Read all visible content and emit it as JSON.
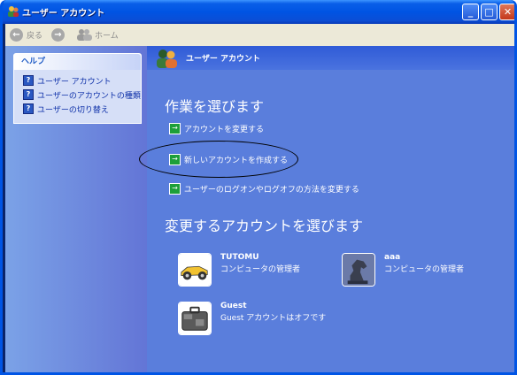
{
  "window": {
    "title": "ユーザー アカウント",
    "minimize": "_",
    "maximize": "□",
    "close": "✕"
  },
  "toolbar": {
    "back_label": "戻る",
    "home_label": "ホーム",
    "back_glyph": "←",
    "forward_glyph": "→"
  },
  "help": {
    "title": "ヘルプ",
    "items": [
      {
        "label": "ユーザー アカウント"
      },
      {
        "label": "ユーザーのアカウントの種類"
      },
      {
        "label": "ユーザーの切り替え"
      }
    ],
    "icon_glyph": "?"
  },
  "header": {
    "title": "ユーザー アカウント"
  },
  "tasks": {
    "heading": "作業を選びます",
    "arrow_glyph": "→",
    "items": [
      {
        "label": "アカウントを変更する"
      },
      {
        "label": "新しいアカウントを作成する"
      },
      {
        "label": "ユーザーのログオンやログオフの方法を変更する"
      }
    ]
  },
  "accounts": {
    "heading": "変更するアカウントを選びます",
    "items": [
      {
        "name": "TUTOMU",
        "role": "コンピュータの管理者",
        "picture": "race-car"
      },
      {
        "name": "aaa",
        "role": "コンピュータの管理者",
        "picture": "horse-chess-piece"
      },
      {
        "name": "Guest",
        "role": "Guest アカウントはオフです",
        "picture": "suitcase"
      }
    ]
  },
  "colors": {
    "titlebar": "#0054e3",
    "content": "#5a7edc",
    "sidepane": "#7ba2e7",
    "task_icon": "#1d9f3a"
  }
}
